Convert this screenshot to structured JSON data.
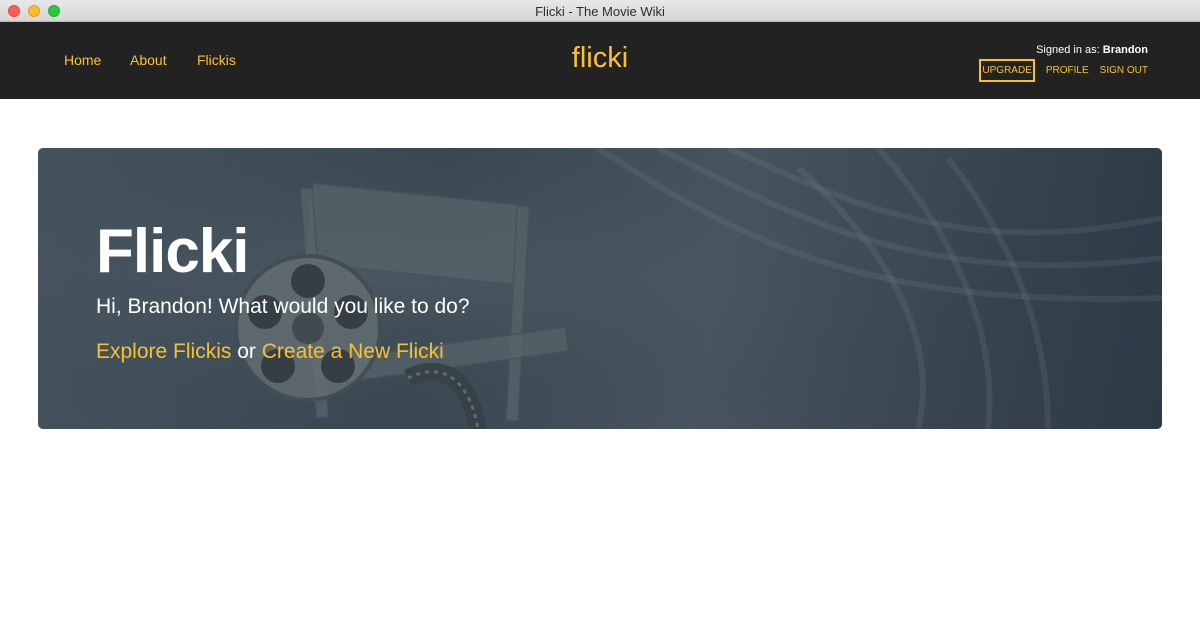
{
  "window": {
    "title": "Flicki - The Movie Wiki"
  },
  "nav": {
    "links": [
      "Home",
      "About",
      "Flickis"
    ],
    "brand": "flicki",
    "signed_in_prefix": "Signed in as:",
    "username": "Brandon",
    "upgrade_label": "UPGRADE",
    "profile_label": "PROFILE",
    "signout_label": "SIGN OUT"
  },
  "hero": {
    "title": "Flicki",
    "greeting": "Hi, Brandon! What would you like to do?",
    "explore_label": "Explore Flickis",
    "or_text": "or",
    "create_label": "Create a New Flicki"
  },
  "colors": {
    "accent": "#f7c133",
    "navbar_bg": "#222222",
    "hero_bg": "#3f4d58"
  },
  "icons": [
    "director-chair-film-reel-image"
  ]
}
